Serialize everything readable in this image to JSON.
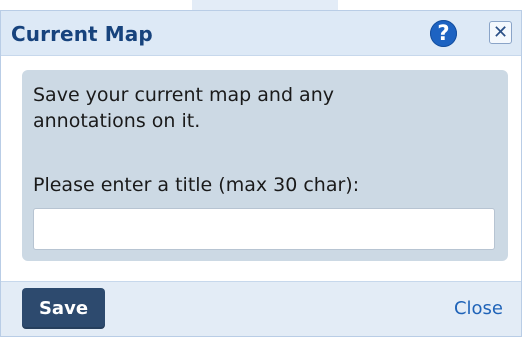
{
  "dialog": {
    "title": "Current Map",
    "help_icon": "help-icon",
    "help_glyph": "?",
    "close_icon": "close-icon",
    "close_glyph": "✕"
  },
  "content": {
    "description": "Save your current map and any annotations on it.",
    "title_label": "Please enter a title (max 30 char):",
    "title_input": {
      "value": "",
      "placeholder": ""
    }
  },
  "footer": {
    "save_label": "Save",
    "close_label": "Close"
  },
  "colors": {
    "title_text": "#17437d",
    "help_icon_bg": "#1d63c2",
    "save_button_bg": "#2d4a6e",
    "close_link": "#1f63b8",
    "content_panel": "#ccd9e4"
  }
}
